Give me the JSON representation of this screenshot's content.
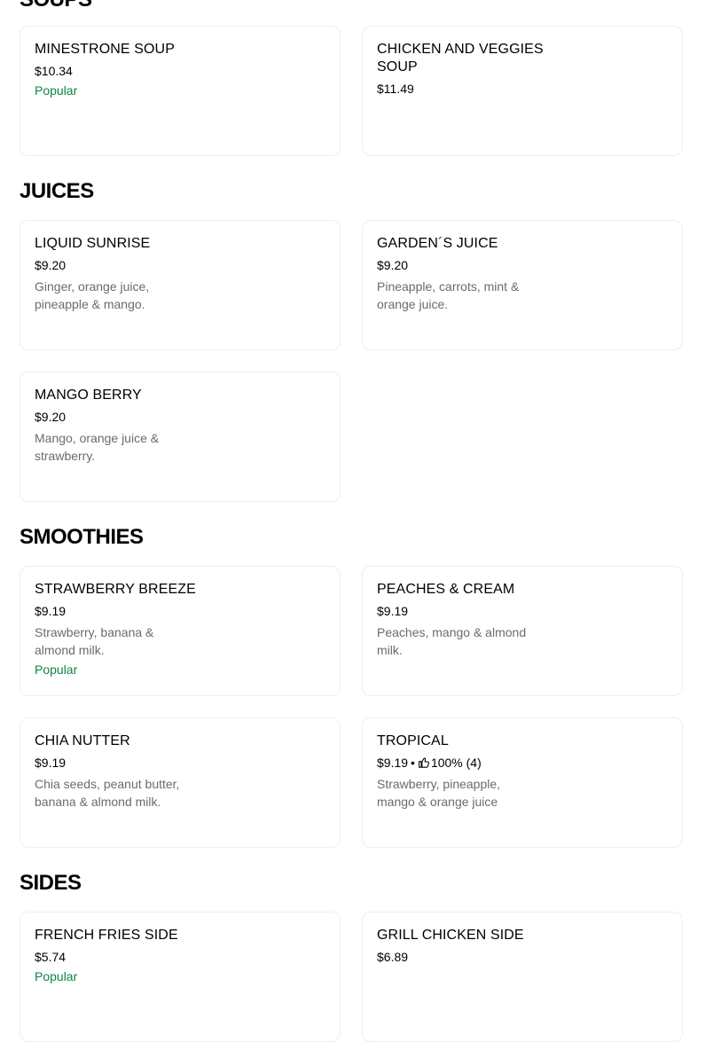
{
  "sections": {
    "soups": {
      "title": "SOUPS",
      "items": [
        {
          "name": "MINESTRONE SOUP",
          "price": "$10.34",
          "badge": "Popular"
        },
        {
          "name": "CHICKEN AND VEGGIES SOUP",
          "price": "$11.49"
        }
      ]
    },
    "juices": {
      "title": "JUICES",
      "items": [
        {
          "name": "LIQUID SUNRISE",
          "price": "$9.20",
          "description": "Ginger, orange juice, pineapple & mango."
        },
        {
          "name": "GARDEN´S JUICE",
          "price": "$9.20",
          "description": "Pineapple, carrots, mint & orange juice."
        },
        {
          "name": "MANGO BERRY",
          "price": "$9.20",
          "description": "Mango, orange juice & strawberry."
        }
      ]
    },
    "smoothies": {
      "title": "SMOOTHIES",
      "items": [
        {
          "name": "STRAWBERRY BREEZE",
          "price": "$9.19",
          "description": "Strawberry, banana & almond milk.",
          "badge": "Popular"
        },
        {
          "name": "PEACHES & CREAM",
          "price": "$9.19",
          "description": "Peaches, mango & almond milk."
        },
        {
          "name": "CHIA NUTTER",
          "price": "$9.19",
          "description": "Chia seeds, peanut butter, banana & almond milk."
        },
        {
          "name": "TROPICAL",
          "price": "$9.19",
          "separator": "•",
          "rating": "100% (4)",
          "rating_icon": "thumbs-up-icon",
          "description": "Strawberry, pineapple, mango & orange juice"
        }
      ]
    },
    "sides": {
      "title": "SIDES",
      "items": [
        {
          "name": "FRENCH FRIES SIDE",
          "price": "$5.74",
          "badge": "Popular"
        },
        {
          "name": "GRILL CHICKEN SIDE",
          "price": "$6.89"
        }
      ]
    }
  },
  "colors": {
    "popular_badge": "#0e8345",
    "description_text": "#6b6b6b",
    "card_border": "#eeeeee"
  }
}
